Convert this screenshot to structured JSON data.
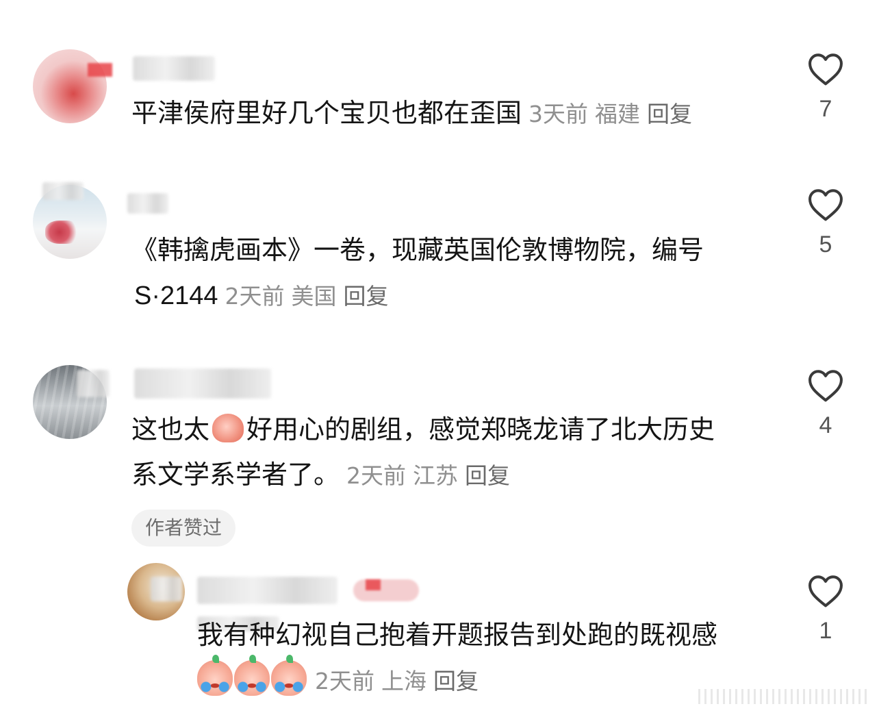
{
  "comments": [
    {
      "text": "平津侯府里好几个宝贝也都在歪国",
      "time": "3天前",
      "location": "福建",
      "reply_label": "回复",
      "likes": "7"
    },
    {
      "line1": "《韩擒虎画本》一卷，现藏英国伦敦博物院，编号",
      "line2": "S·2144",
      "time": "2天前",
      "location": "美国",
      "reply_label": "回复",
      "likes": "5"
    },
    {
      "line1_a": "这也太",
      "line1_b": "好用心的剧组，感觉郑晓龙请了北大历史",
      "line2": "系文学系学者了。",
      "time": "2天前",
      "location": "江苏",
      "reply_label": "回复",
      "likes": "4",
      "badge": "作者赞过"
    },
    {
      "line1": "我有种幻视自己抱着开题报告到处跑的既视感",
      "time": "2天前",
      "location": "上海",
      "reply_label": "回复",
      "likes": "1"
    }
  ],
  "icons": {
    "like": "heart-outline-icon",
    "emoji_thumb": "thumbs-up-emoji",
    "emoji_cry": "crying-laughing-emoji"
  },
  "colors": {
    "text": "#141414",
    "meta": "#8f8f8f",
    "badge_bg": "#f2f2f2"
  }
}
